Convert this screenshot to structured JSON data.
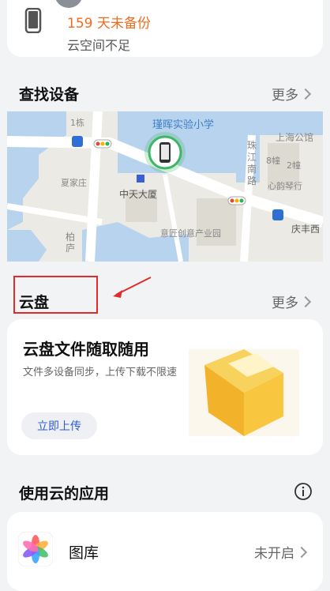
{
  "backup": {
    "status": "159 天未备份",
    "subtitle": "云空间不足"
  },
  "find_device": {
    "title": "查找设备",
    "more": "更多",
    "map_labels": [
      "瑾晖实验小学",
      "1栋",
      "上海公馆",
      "珠江南路",
      "8幢",
      "2幢",
      "心韵琴行",
      "夏家庄",
      "中天大厦",
      "柏庐",
      "意匠创意产业园",
      "庆丰西"
    ]
  },
  "cloud_drive": {
    "title": "云盘",
    "more": "更多",
    "card_title": "云盘文件随取随用",
    "card_desc": "文件多设备同步，上传下载不限速",
    "upload_button": "立即上传"
  },
  "apps": {
    "title": "使用云的应用",
    "items": [
      {
        "label": "图库",
        "status": "未开启"
      }
    ]
  },
  "colors": {
    "orange": "#f06b1e",
    "blue_button_text": "#2f5bd8",
    "annotation_red": "#e02b2b"
  }
}
